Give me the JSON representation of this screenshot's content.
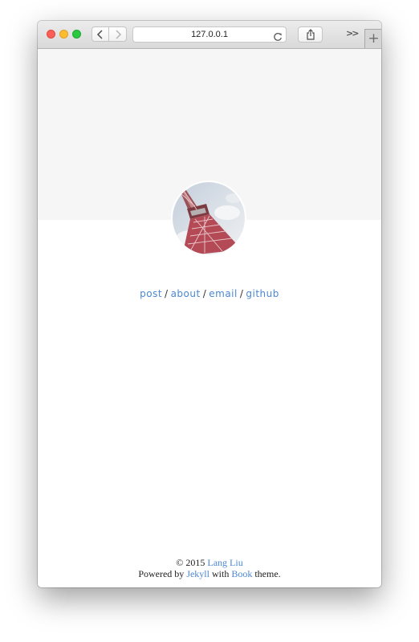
{
  "browser": {
    "url": "127.0.0.1"
  },
  "nav": {
    "links": [
      "post",
      "about",
      "email",
      "github"
    ],
    "separator": "/"
  },
  "footer": {
    "line1": {
      "prefix": "© 2015",
      "author_link": "Lang Liu"
    },
    "line2": {
      "prefix": "Powered by",
      "jekyll_link": "Jekyll",
      "middle": "with",
      "book_link": "Book",
      "suffix": "theme."
    }
  },
  "colors": {
    "link": "#4a87d6",
    "header_band": "#f6f6f6",
    "close_light": "#fc5f57",
    "minimize_light": "#fdbc2e",
    "zoom_light": "#28c840"
  },
  "icons": {
    "back": "chevron-left-icon",
    "forward": "chevron-right-icon",
    "reload": "reload-icon",
    "share": "share-icon",
    "overflow": "double-chevron-icon",
    "new_tab": "plus-icon"
  }
}
